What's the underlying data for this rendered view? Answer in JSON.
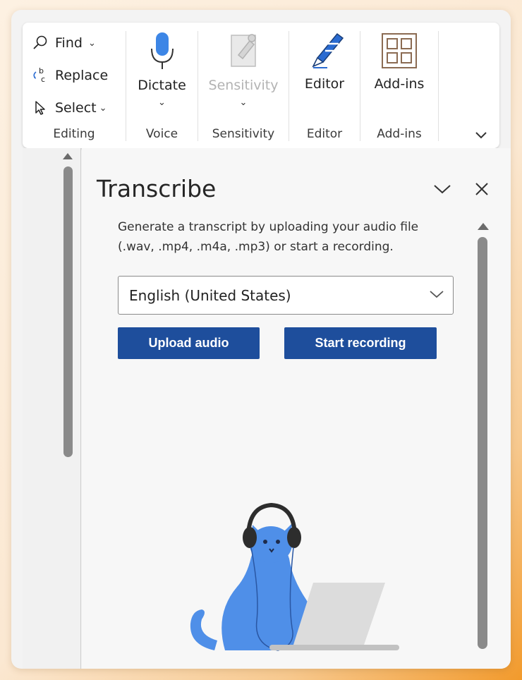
{
  "ribbon": {
    "editing": {
      "find": "Find",
      "replace": "Replace",
      "select": "Select",
      "group_label": "Editing"
    },
    "voice": {
      "dictate": "Dictate",
      "group_label": "Voice"
    },
    "sensitivity": {
      "button": "Sensitivity",
      "group_label": "Sensitivity"
    },
    "editor": {
      "button": "Editor",
      "group_label": "Editor"
    },
    "addins": {
      "button": "Add-ins",
      "group_label": "Add-ins"
    }
  },
  "pane": {
    "title": "Transcribe",
    "description": "Generate a transcript by uploading your audio file (.wav, .mp4, .m4a, .mp3) or start a recording.",
    "language": {
      "selected": "English (United States)"
    },
    "upload_label": "Upload audio",
    "record_label": "Start recording"
  },
  "icons": {
    "find": "search-icon",
    "replace": "replace-icon",
    "select": "cursor-icon",
    "dictate": "microphone-icon",
    "sensitivity": "sensitivity-icon",
    "editor": "editor-pen-icon",
    "addins": "grid-icon"
  },
  "colors": {
    "primary_button": "#1e4e9c",
    "accent_blue": "#2a6bd1"
  }
}
